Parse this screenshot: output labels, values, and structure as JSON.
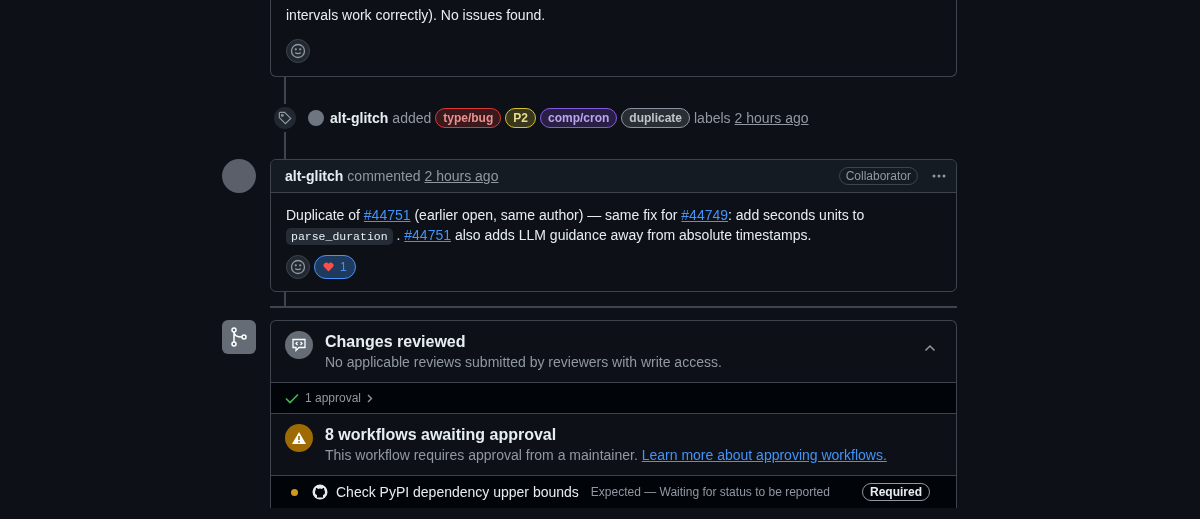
{
  "previous_comment": {
    "body_tail": "intervals work correctly). No issues found."
  },
  "label_event": {
    "actor": "alt-glitch",
    "action": "added",
    "labels": [
      {
        "name": "type/bug",
        "color": "#da3633"
      },
      {
        "name": "P2",
        "color": "#d4c22c"
      },
      {
        "name": "comp/cron",
        "color": "#8957e5"
      },
      {
        "name": "duplicate",
        "color": "#8b949e"
      }
    ],
    "suffix": "labels",
    "time": "2 hours ago"
  },
  "comment": {
    "author": "alt-glitch",
    "action": "commented",
    "time": "2 hours ago",
    "role": "Collaborator",
    "body": [
      {
        "kind": "text",
        "text": "Duplicate of "
      },
      {
        "kind": "link",
        "text": "#44751"
      },
      {
        "kind": "text",
        "text": " (earlier open, same author) — same fix for "
      },
      {
        "kind": "link",
        "text": "#44749"
      },
      {
        "kind": "text",
        "text": ": add seconds units to "
      },
      {
        "kind": "code",
        "text": "parse_duration"
      },
      {
        "kind": "text",
        "text": " . "
      },
      {
        "kind": "link",
        "text": "#44751"
      },
      {
        "kind": "text",
        "text": " also adds LLM guidance away from absolute timestamps."
      }
    ],
    "reactions": [
      {
        "count": "1",
        "selected": true
      }
    ]
  },
  "merge_box": {
    "review": {
      "title": "Changes reviewed",
      "subtitle": "No applicable reviews submitted by reviewers with write access.",
      "expanded": true,
      "approvals": "1 approval"
    },
    "workflows": {
      "title": "8 workflows awaiting approval",
      "text": "This workflow requires approval from a maintainer.",
      "link": "Learn more about approving workflows."
    },
    "checks": [
      {
        "name": "Check PyPI dependency upper bounds",
        "status": "Expected — Waiting for status to be reported",
        "badge": "Required",
        "color": "#d29922"
      }
    ]
  }
}
